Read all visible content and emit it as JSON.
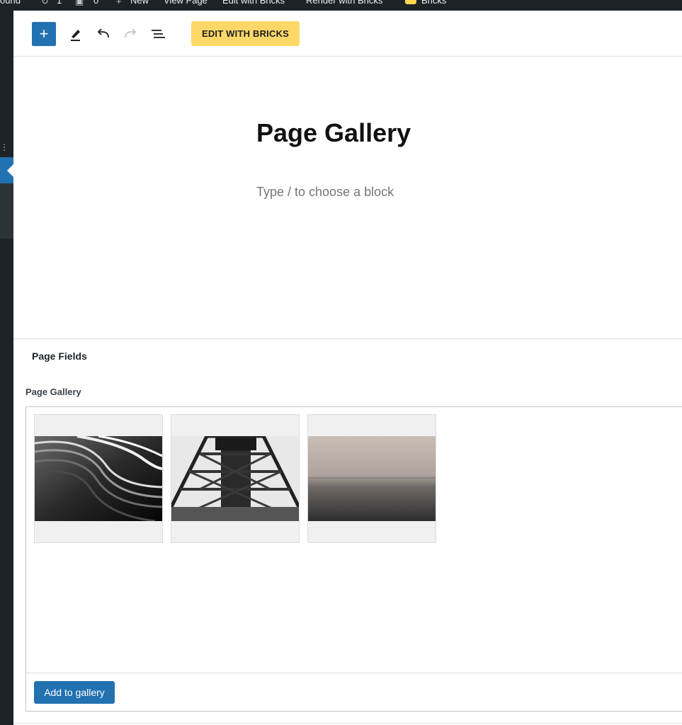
{
  "admin_bar": {
    "items": [
      "ound",
      "1",
      "0",
      "New",
      "View Page",
      "Edit with Bricks",
      "Render with Bricks",
      "Bricks"
    ]
  },
  "toolbar": {
    "inserter_symbol": "+",
    "bricks_button_label": "EDIT WITH BRICKS"
  },
  "editor": {
    "post_title": "Page Gallery",
    "block_placeholder": "Type / to choose a block"
  },
  "meta_box": {
    "title": "Page Fields",
    "field_label": "Page Gallery",
    "images": [
      {
        "name": "architecture-curves",
        "description": "black and white curved facade"
      },
      {
        "name": "steel-tower",
        "description": "black and white lattice tower"
      },
      {
        "name": "misty-sea",
        "description": "sepia sea horizon"
      }
    ],
    "add_button_label": "Add to gallery"
  },
  "colors": {
    "admin_bar": "#1d2327",
    "primary": "#2271b1",
    "bricks_yellow": "#fdd868"
  }
}
